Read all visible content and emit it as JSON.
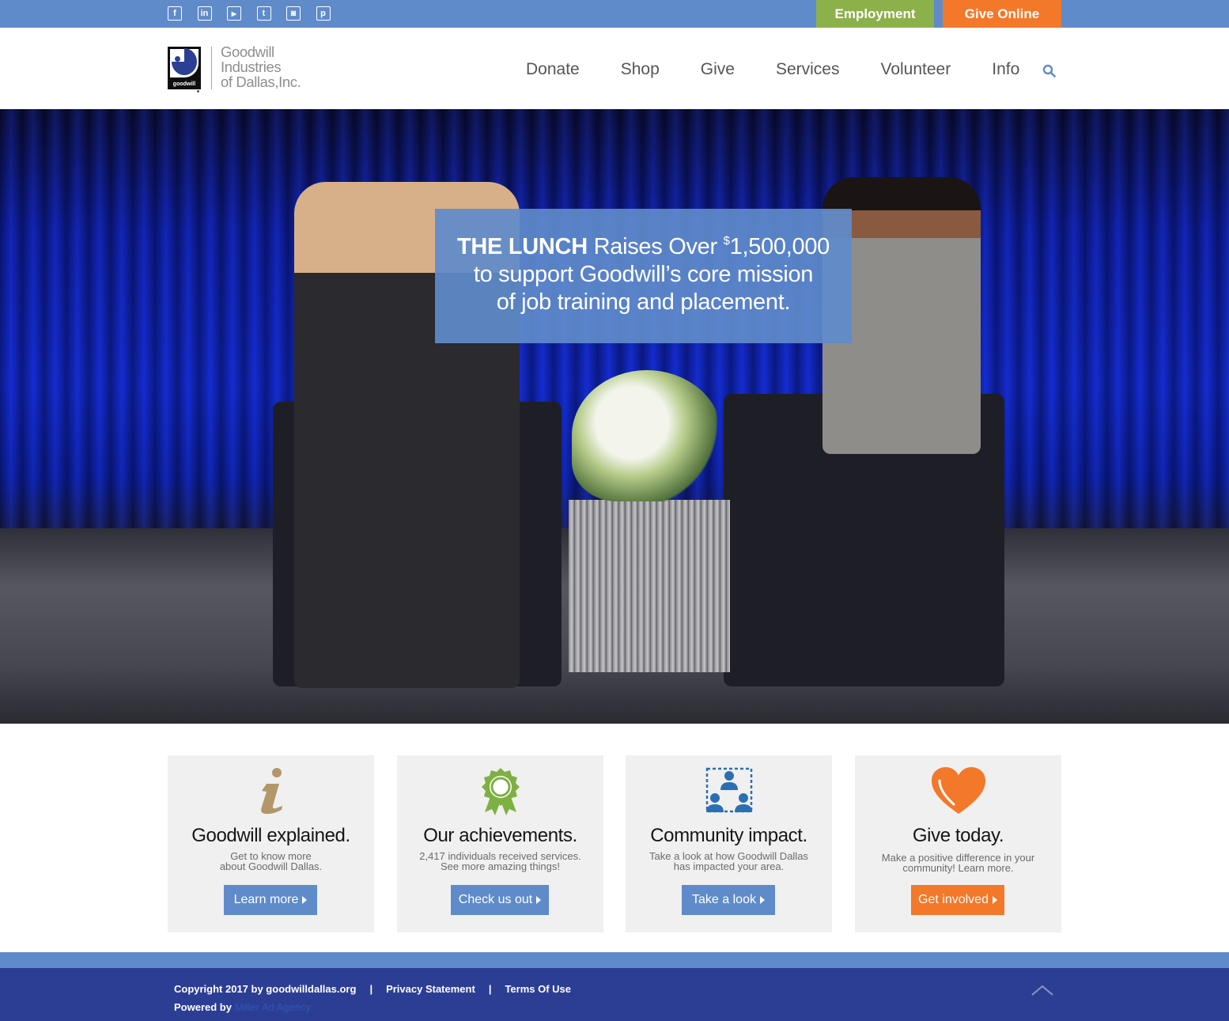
{
  "social": {
    "icons": [
      {
        "name": "facebook-icon",
        "glyph": "f"
      },
      {
        "name": "linkedin-icon",
        "glyph": "in"
      },
      {
        "name": "youtube-icon",
        "glyph": "▶"
      },
      {
        "name": "twitter-icon",
        "glyph": "t"
      },
      {
        "name": "instagram-icon",
        "glyph": "◙"
      },
      {
        "name": "pinterest-icon",
        "glyph": "p"
      }
    ]
  },
  "top_buttons": {
    "employment": "Employment",
    "give_online": "Give Online"
  },
  "logo": {
    "mark_word": "goodwill",
    "line1": "Goodwill",
    "line2": "Industries",
    "line3": "of Dallas,Inc."
  },
  "nav": {
    "items": [
      "Donate",
      "Shop",
      "Give",
      "Services",
      "Volunteer",
      "Info"
    ]
  },
  "hero": {
    "strong": "THE LUNCH",
    "raises": "Raises Over",
    "currency": "$",
    "amount": "1,500,000",
    "line2": "to support Goodwill’s core mission",
    "line3": "of job training and placement."
  },
  "cards": [
    {
      "title": "Goodwill explained.",
      "text1": "Get to know more",
      "text2": "about Goodwill Dallas.",
      "button": "Learn more",
      "icon": "info-icon",
      "button_color": "#5f8bcb"
    },
    {
      "title": "Our achievements.",
      "text1": "2,417 individuals received services.",
      "text2": "See more amazing things!",
      "button": "Check us out",
      "icon": "award-ribbon-icon",
      "button_color": "#5f8bcb"
    },
    {
      "title": "Community impact.",
      "text1": "Take a look at how Goodwill Dallas",
      "text2": "has impacted your area.",
      "button": "Take a look",
      "icon": "community-people-icon",
      "button_color": "#5f8bcb"
    },
    {
      "title": "Give today.",
      "text1": "Make a positive difference in your",
      "text2": "community! Learn more.",
      "button": "Get involved",
      "icon": "heart-icon",
      "button_color": "#f4782a"
    }
  ],
  "footer": {
    "copyright": "Copyright 2017 by goodwilldallas.org",
    "separator": "|",
    "privacy": "Privacy Statement",
    "terms": "Terms Of Use",
    "powered_label": "Powered by",
    "powered_link": "Miller Ad Agency"
  },
  "colors": {
    "top_bar": "#5f8bcb",
    "employment": "#8cb04a",
    "give_online": "#f4782a",
    "footer": "#2c3e94"
  }
}
